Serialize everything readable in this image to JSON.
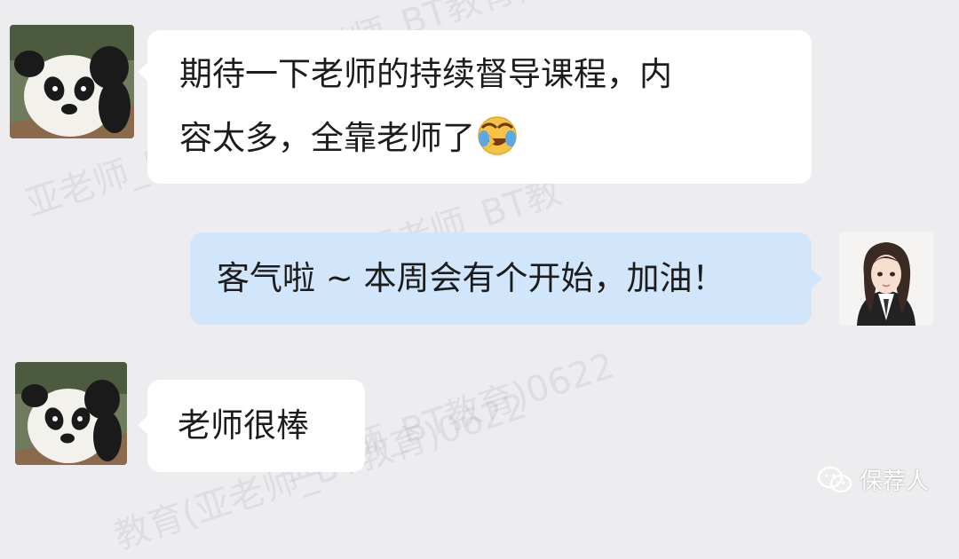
{
  "messages": [
    {
      "side": "left",
      "line1": "期待一下老师的持续督导课程，内",
      "line2": "容太多，全靠老师了",
      "emoji": "laughing-crying-emoji"
    },
    {
      "side": "right",
      "text": "客气啦 ~ 本周会有个开始，加油！"
    },
    {
      "side": "left",
      "text": "老师很棒"
    }
  ],
  "watermark": {
    "a": "亚老师_BT教育)0622",
    "b": "亚老师_BT教育)0622",
    "c": "教育(亚老师_BT教育)0622",
    "d": "BT教育(亚老",
    "e": "亚老师_BT教"
  },
  "signature": {
    "label": "保荐人",
    "icon": "wechat-official-account-icon"
  },
  "colors": {
    "background": "#ededf0",
    "bubble_white": "#ffffff",
    "bubble_blue": "#d2e6fb"
  }
}
